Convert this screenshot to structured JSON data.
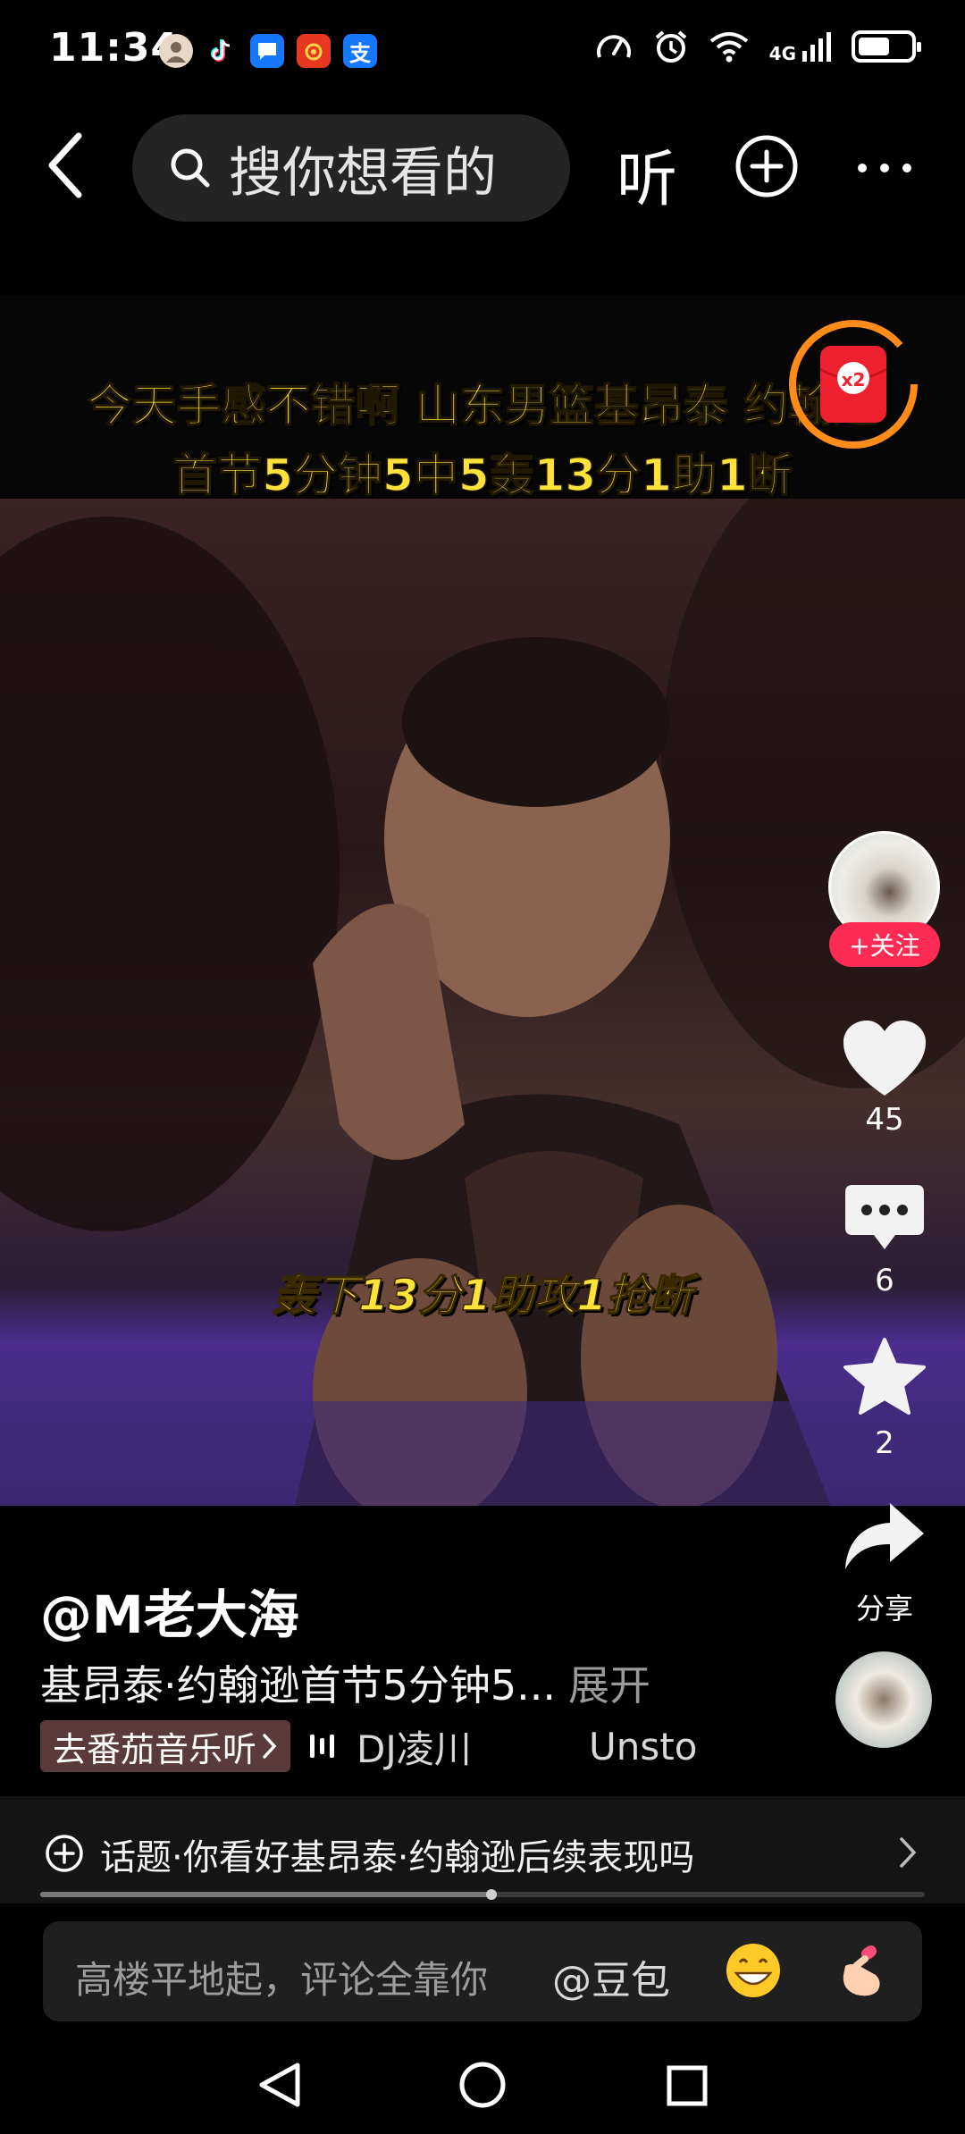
{
  "status_bar": {
    "time": "11:34",
    "notification_icons": [
      "avatar-notification-icon",
      "tiktok-icon",
      "message-icon",
      "weibo-icon",
      "alipay-icon"
    ],
    "alipay_glyph": "支",
    "network_label": "4G",
    "battery_level": 0.6
  },
  "top_bar": {
    "search_placeholder": "搜你想看的",
    "listen_label": "听"
  },
  "video": {
    "caption_line1": "今天手感不错啊 山东男篮基昂泰 约翰逊",
    "caption_line2": "首节5分钟5中5轰13分1助1断",
    "subtitle": "轰下13分1助攻1抢断",
    "red_packet_label": "x2"
  },
  "right_rail": {
    "follow_label": "+关注",
    "like_count": "45",
    "comment_count": "6",
    "favorite_count": "2",
    "share_label": "分享"
  },
  "info": {
    "author": "@M老大海",
    "description": "基昂泰·约翰逊首节5分钟5...",
    "expand_label": "展开",
    "tomato_music_label": "去番茄音乐听",
    "music_title": "DJ凌川",
    "music_title_2": "Unsto"
  },
  "topic": {
    "text": "话题·你看好基昂泰·约翰逊后续表现吗"
  },
  "progress": 0.51,
  "comment_bar": {
    "placeholder": "高楼平地起，评论全靠你",
    "mention": "@豆包"
  },
  "colors": {
    "accent": "#fe2c55",
    "caption_yellow": "#ffe23a"
  }
}
